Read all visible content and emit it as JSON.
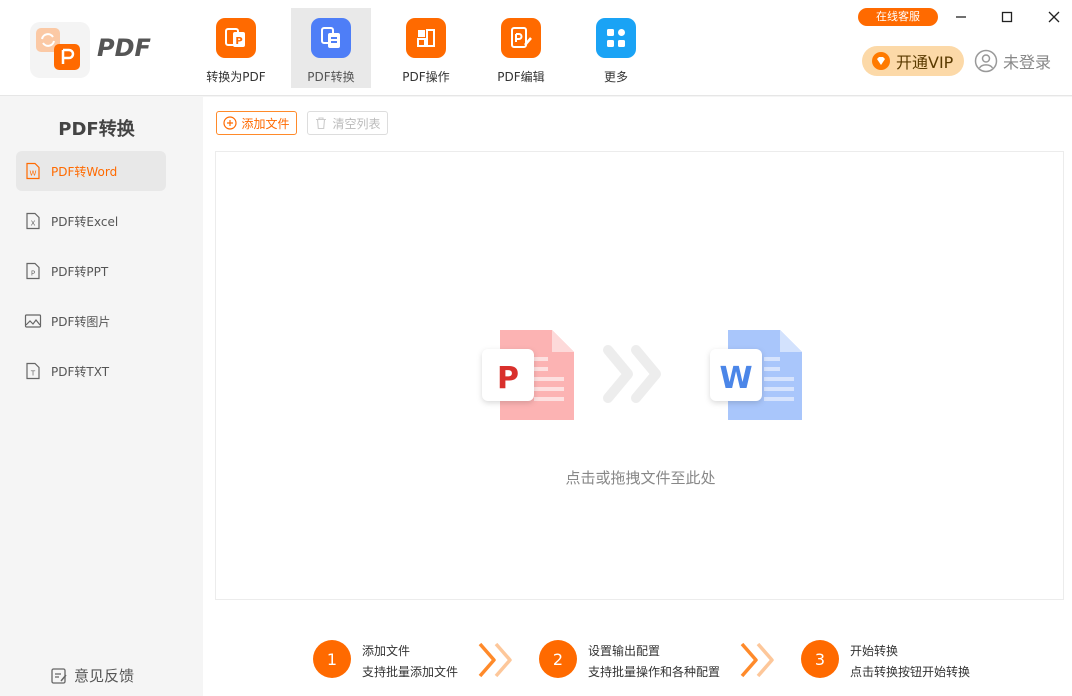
{
  "app": {
    "logo_text": "PDF"
  },
  "nav": [
    {
      "label": "转换为PDF",
      "icon": "convert-to-pdf-icon"
    },
    {
      "label": "PDF转换",
      "icon": "pdf-convert-icon"
    },
    {
      "label": "PDF操作",
      "icon": "pdf-operate-icon"
    },
    {
      "label": "PDF编辑",
      "icon": "pdf-edit-icon"
    },
    {
      "label": "更多",
      "icon": "more-grid-icon"
    }
  ],
  "header": {
    "service_label": "在线客服",
    "vip_label": "开通VIP",
    "login_label": "未登录"
  },
  "sidebar": {
    "title": "PDF转换",
    "items": [
      {
        "label": "PDF转Word",
        "icon": "word-file-icon",
        "active": true
      },
      {
        "label": "PDF转Excel",
        "icon": "excel-file-icon"
      },
      {
        "label": "PDF转PPT",
        "icon": "ppt-file-icon"
      },
      {
        "label": "PDF转图片",
        "icon": "image-icon"
      },
      {
        "label": "PDF转TXT",
        "icon": "txt-file-icon"
      }
    ],
    "feedback_label": "意见反馈"
  },
  "toolbar": {
    "add_label": "添加文件",
    "clear_label": "清空列表"
  },
  "dropzone": {
    "hint": "点击或拖拽文件至此处",
    "from_letter": "P",
    "to_letter": "W"
  },
  "steps": [
    {
      "num": "1",
      "title": "添加文件",
      "desc": "支持批量添加文件"
    },
    {
      "num": "2",
      "title": "设置输出配置",
      "desc": "支持批量操作和各种配置"
    },
    {
      "num": "3",
      "title": "开始转换",
      "desc": "点击转换按钮开始转换"
    }
  ],
  "colors": {
    "accent": "#ff6a00",
    "blue": "#4e7ef7"
  }
}
